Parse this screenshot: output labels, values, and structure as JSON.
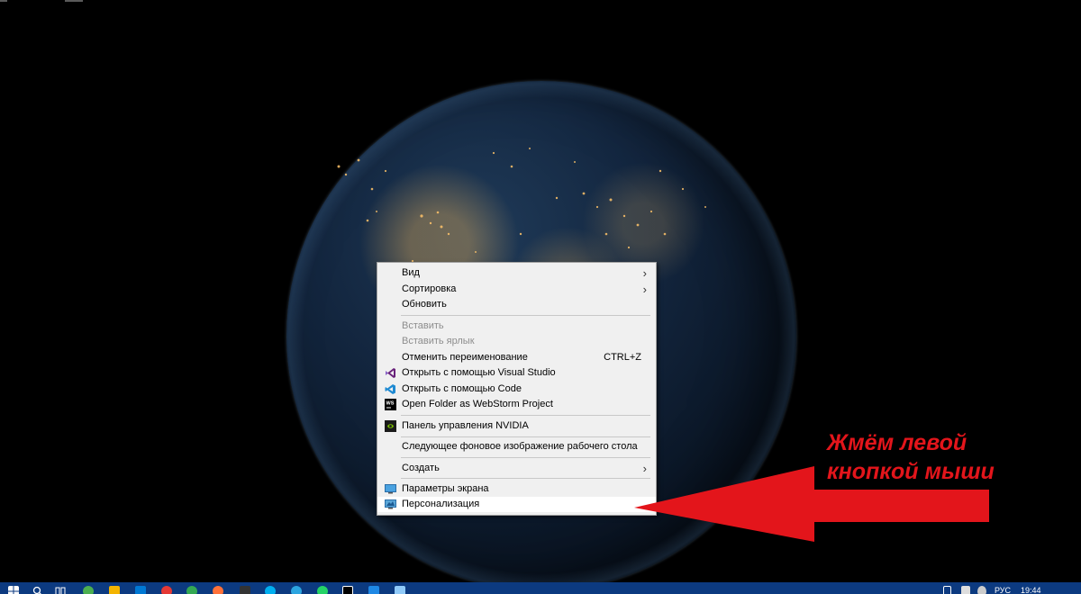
{
  "context_menu": {
    "items": [
      {
        "label": "Вид"
      },
      {
        "label": "Сортировка"
      },
      {
        "label": "Обновить"
      },
      {
        "label": "Вставить"
      },
      {
        "label": "Вставить ярлык"
      },
      {
        "label": "Отменить переименование",
        "shortcut": "CTRL+Z"
      },
      {
        "label": "Открыть с помощью Visual Studio",
        "icon": "visual-studio-icon"
      },
      {
        "label": "Открыть с помощью Code",
        "icon": "vscode-icon"
      },
      {
        "label": "Open Folder as WebStorm Project",
        "icon": "webstorm-icon"
      },
      {
        "label": "Панель управления NVIDIA",
        "icon": "nvidia-icon"
      },
      {
        "label": "Следующее фоновое изображение рабочего стола"
      },
      {
        "label": "Создать"
      },
      {
        "label": "Параметры экрана",
        "icon": "display-settings-icon"
      },
      {
        "label": "Персонализация",
        "icon": "personalization-icon"
      }
    ]
  },
  "annotation": {
    "line1": "Жмём левой",
    "line2": "кнопкой мыши",
    "color": "#e3151b"
  },
  "taskbar": {
    "lang": "РУС",
    "clock": "19:44",
    "color": "#0c3a80"
  }
}
